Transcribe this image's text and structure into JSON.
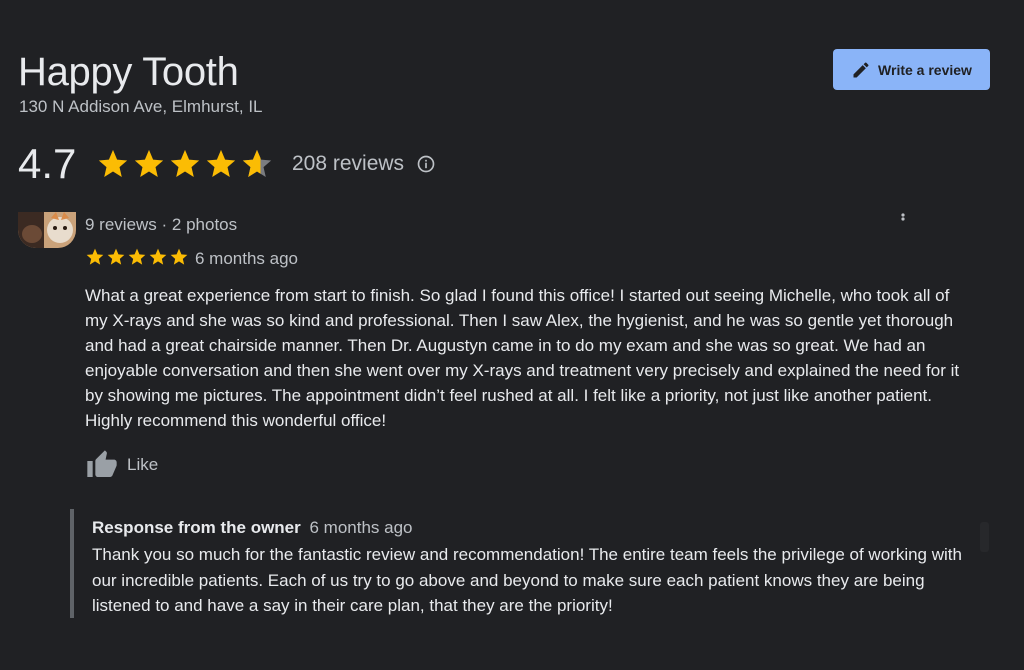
{
  "business": {
    "name": "Happy Tooth",
    "address": "130 N Addison Ave, Elmhurst, IL",
    "rating": "4.7",
    "rating_value": 4.7,
    "reviews_count": "208 reviews"
  },
  "actions": {
    "write_review_label": "Write a review"
  },
  "review": {
    "meta": "9 reviews · 2 photos",
    "stars": 5,
    "date": "6 months ago",
    "text": "What a great experience from start to finish. So glad I found this office! I started out seeing Michelle, who took all of my X-rays and she was so kind and professional. Then I saw Alex, the hygienist, and he was so gentle yet thorough and had a great chairside manner. Then Dr. Augustyn came in to do my exam and she was so great. We had an enjoyable conversation and then she went over my X-rays and treatment very precisely and explained the need for it by showing me pictures. The appointment didn’t feel rushed at all. I felt like a priority, not just like another patient. Highly recommend this wonderful office!",
    "like_label": "Like"
  },
  "owner_response": {
    "heading": "Response from the owner",
    "date": "6 months ago",
    "text": "Thank you so much for the fantastic review and recommendation! The entire team feels the privilege of working with our incredible patients. Each of us try to go above and beyond to make sure each patient knows they are being listened to and have a say in their care plan, that they are the priority!"
  },
  "colors": {
    "background": "#202124",
    "star": "#fbbc04",
    "accent_button": "#8ab4f8"
  },
  "icons": [
    "pencil-icon",
    "star-icon",
    "info-icon",
    "more-vert-icon",
    "thumbs-up-icon"
  ]
}
